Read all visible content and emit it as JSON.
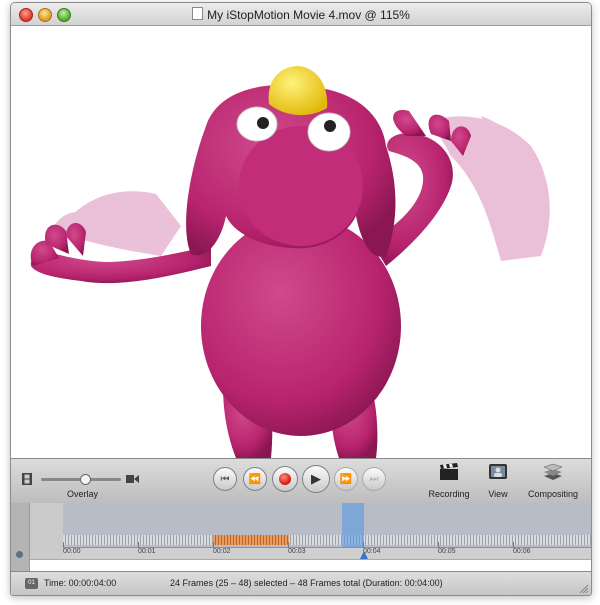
{
  "window": {
    "title": "My iStopMotion Movie 4.mov @ 115%"
  },
  "preview": {
    "subject": "pink clay creature with yellow hat"
  },
  "toolbar": {
    "overlay_label": "Overlay",
    "overlay_value": 0.55,
    "transport": {
      "to_start": "⏮",
      "step_back": "⏪",
      "play": "▶",
      "step_forward": "⏩",
      "to_end": "⏭"
    },
    "recording_label": "Recording",
    "view_label": "View",
    "compositing_label": "Compositing"
  },
  "timeline": {
    "ticks": [
      "00:00",
      "00:01",
      "00:02",
      "00:03",
      "00:04",
      "00:05",
      "00:06"
    ]
  },
  "status": {
    "icon_text": "01",
    "time": "Time: 00:00:04:00",
    "summary": "24 Frames (25 – 48) selected – 48 Frames total (Duration: 00:04:00)"
  },
  "colors": {
    "clay_pink": "#b8246e",
    "clay_hat": "#f2d21a",
    "selection_blue": "#5096e6",
    "frame_orange": "#f09a5a",
    "record_red": "#d0160a"
  }
}
